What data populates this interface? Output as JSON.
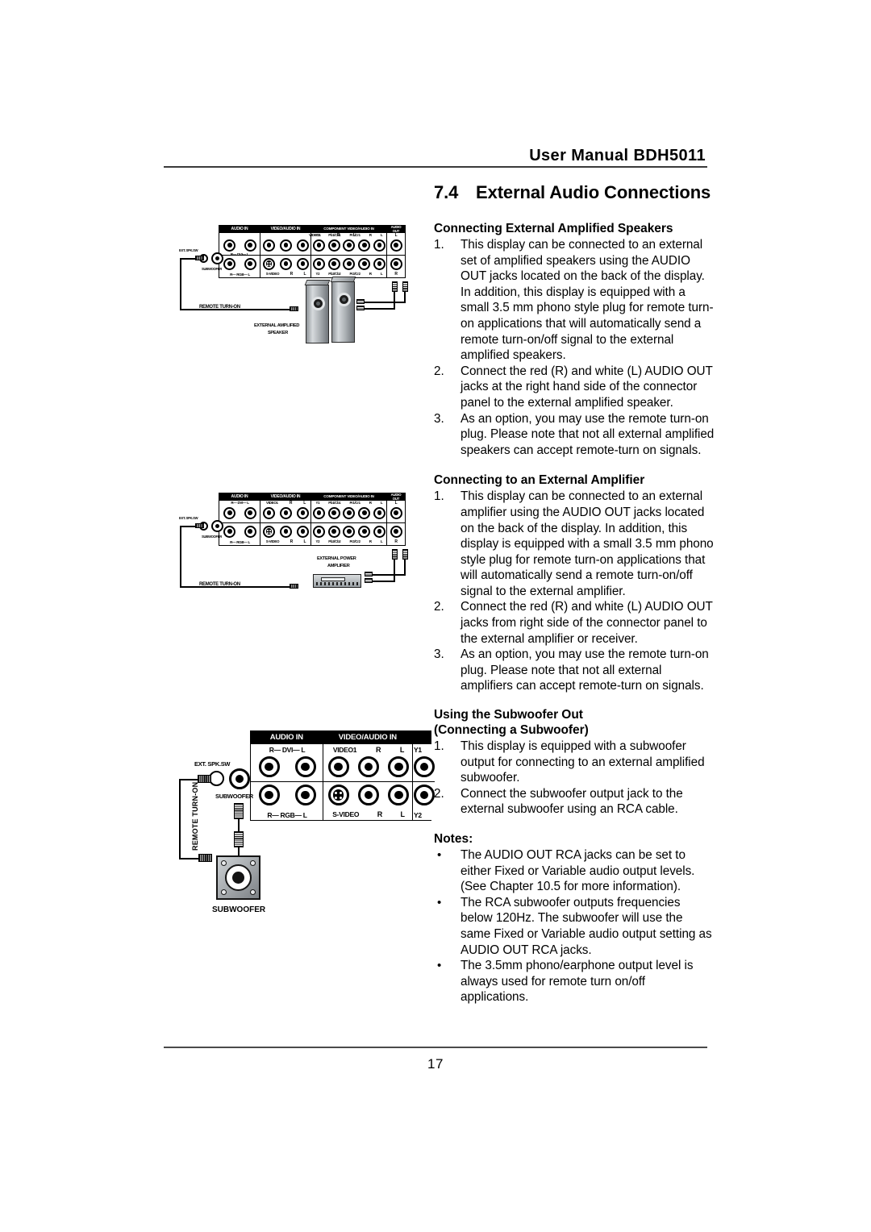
{
  "header": {
    "title": "User Manual BDH5011"
  },
  "footer": {
    "page_number": "17"
  },
  "section": {
    "number": "7.4",
    "title": "External Audio Connections"
  },
  "blocks": {
    "speakers": {
      "heading": "Connecting External Amplified Speakers",
      "steps": [
        {
          "marker": "1.",
          "text": "This display can be connected to an external set of amplified speakers using the AUDIO OUT jacks located on the back of the display. In addition, this display is equipped with a small 3.5 mm phono style plug for remote turn-on applications that will automatically send a remote turn-on/off signal to the external amplified speakers."
        },
        {
          "marker": "2.",
          "text": "Connect the red (R) and white (L) AUDIO OUT jacks at the right hand side of the connector panel to the external amplified speaker."
        },
        {
          "marker": "3.",
          "text": "As an option, you may use the remote turn-on plug. Please note that not all external amplified speakers can accept remote-turn on signals."
        }
      ]
    },
    "amplifier": {
      "heading": "Connecting to an External Amplifier",
      "steps": [
        {
          "marker": "1.",
          "text": "This display can be connected to an external amplifier using the AUDIO OUT jacks located on the back of the display. In addition, this display is equipped with a small 3.5 mm phono style plug for remote turn-on applications that will automatically send a remote turn-on/off signal to the external amplifier."
        },
        {
          "marker": "2.",
          "text": "Connect the red (R) and white (L) AUDIO OUT jacks from right side of the connector panel to the external amplifier or receiver."
        },
        {
          "marker": "3.",
          "text": "As an option, you may use the remote turn-on plug. Please note that not all external amplifiers can accept remote-turn on signals."
        }
      ]
    },
    "subwoofer": {
      "heading_line1": "Using the Subwoofer Out",
      "heading_line2": "(Connecting a Subwoofer)",
      "steps": [
        {
          "marker": "1.",
          "text": "This display is equipped with a subwoofer output for connecting to an external amplified subwoofer."
        },
        {
          "marker": "2.",
          "text": "Connect the subwoofer output jack to the external subwoofer using an RCA cable."
        }
      ]
    },
    "notes": {
      "title": "Notes:",
      "items": [
        {
          "marker": "•",
          "text": "The AUDIO OUT RCA jacks can be set to either Fixed or Variable audio output levels. (See Chapter 10.5 for more information)."
        },
        {
          "marker": "•",
          "text": "The RCA subwoofer outputs frequencies below 120Hz. The subwoofer will use the same Fixed or Variable audio output setting as AUDIO OUT RCA jacks."
        },
        {
          "marker": "•",
          "text": "The 3.5mm phono/earphone output level is always used for remote turn on/off applications."
        }
      ]
    }
  },
  "panel": {
    "groups": {
      "audio_in": "AUDIO IN",
      "video_audio_in": "VIDEO/AUDIO IN",
      "component": "COMPONENT VIDEO/AUDIO IN",
      "audio_out": "AUDIO OUT"
    },
    "labels": {
      "dvi": "R— DVI— L",
      "rgb": "R— RGB— L",
      "video1": "VIDEO1",
      "svideo": "S-VIDEO",
      "r": "R",
      "l": "L",
      "y1": "Y1",
      "y2": "Y2",
      "pb1": "Pb1/Cb1",
      "pr1": "Pr1/Cr1",
      "pb2": "Pb2/Cb2",
      "pr2": "Pr2/Cr2"
    },
    "side": {
      "ext_spk_sw": "EXT. SPK.SW",
      "subwoofer": "SUBWOOFER"
    }
  },
  "diagram1": {
    "remote_turn_on": "REMOTE TURN-ON",
    "device_label_line1": "EXTERNAL AMPLIFIED",
    "device_label_line2": "SPEAKER"
  },
  "diagram2": {
    "remote_turn_on": "REMOTE TURN-ON",
    "device_label_line1": "EXTERNAL POWER",
    "device_label_line2": "AMPLIFIER"
  },
  "diagram3": {
    "remote_turn_on": "REMOTE TURN-ON",
    "device_label": "SUBWOOFER"
  }
}
